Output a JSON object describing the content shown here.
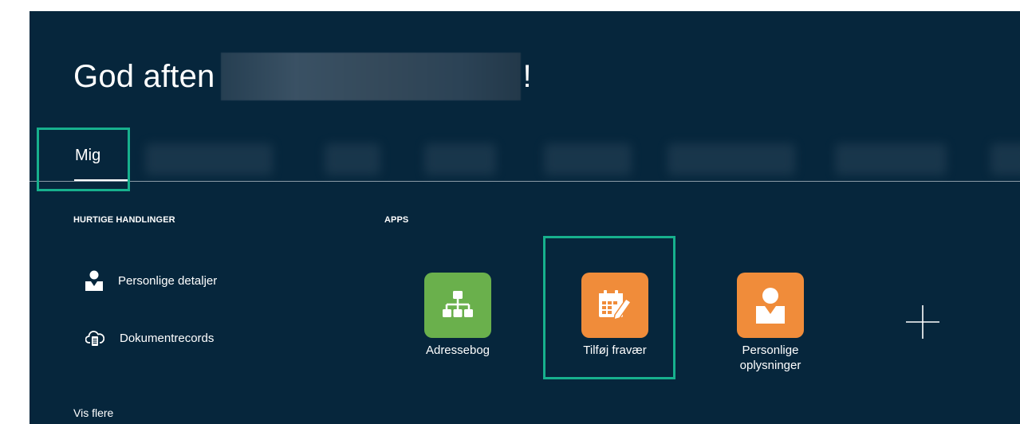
{
  "greeting": {
    "text": "God aften",
    "suffix": "!"
  },
  "tabs": {
    "active": "Mig"
  },
  "quick_actions": {
    "heading": "HURTIGE HANDLINGER",
    "items": [
      {
        "label": "Personlige detaljer",
        "icon": "person-icon"
      },
      {
        "label": "Dokumentrecords",
        "icon": "cloud-document-icon"
      }
    ],
    "more": "Vis flere"
  },
  "apps": {
    "heading": "APPS",
    "items": [
      {
        "label": "Adressebog",
        "icon": "org-chart-icon",
        "color": "#6ab04c"
      },
      {
        "label": "Tilføj fravær",
        "icon": "calendar-edit-icon",
        "color": "#f08c3a"
      },
      {
        "label_line1": "Personlige",
        "label_line2": "oplysninger",
        "icon": "person-icon",
        "color": "#f08c3a"
      }
    ],
    "add_icon": "plus-icon"
  },
  "colors": {
    "background": "#06263c",
    "highlight": "#17b08d"
  }
}
